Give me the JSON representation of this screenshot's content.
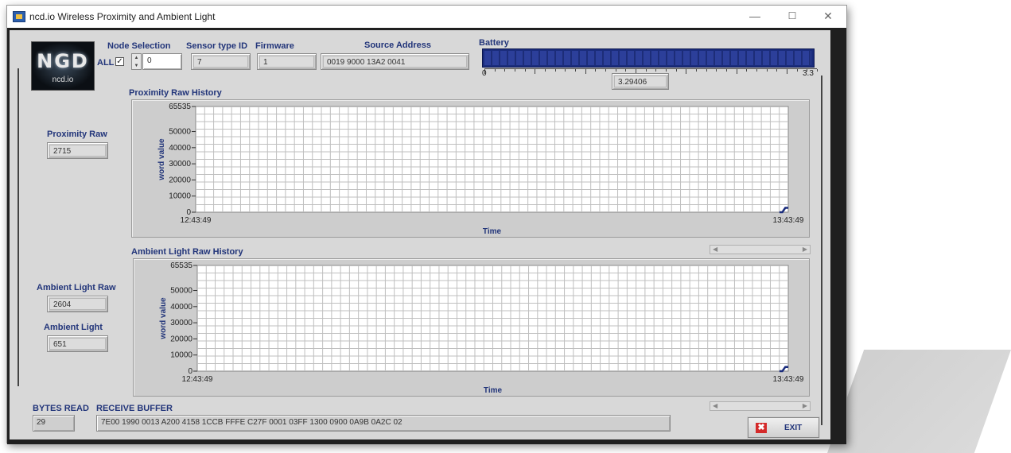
{
  "window": {
    "title": "ncd.io Wireless Proximity and Ambient Light"
  },
  "logo": {
    "brand": "NGD",
    "subtitle": "ncd.io"
  },
  "node_selection": {
    "label": "Node Selection",
    "all_label": "ALL",
    "all_checked": true,
    "value": "0"
  },
  "sensor_type": {
    "label": "Sensor type ID",
    "value": "7"
  },
  "firmware": {
    "label": "Firmware",
    "value": "1"
  },
  "source_address": {
    "label": "Source Address",
    "value": "0019 9000 13A2 0041"
  },
  "battery": {
    "label": "Battery",
    "min": "0",
    "max": "3.3",
    "value": "3.29406",
    "level_fraction": 0.998
  },
  "proximity_raw": {
    "label": "Proximity Raw",
    "value": "2715"
  },
  "ambient_light_raw": {
    "label": "Ambient Light Raw",
    "value": "2604"
  },
  "ambient_light": {
    "label": "Ambient Light",
    "value": "651"
  },
  "bytes_read": {
    "label": "BYTES READ",
    "value": "29"
  },
  "receive_buffer": {
    "label": "RECEIVE BUFFER",
    "value": "7E00 1990 0013 A200 4158 1CCB FFFE C27F 0001 03FF 1300 0900 0A9B 0A2C 02"
  },
  "exit_button": {
    "label": "EXIT"
  },
  "colors": {
    "label_blue": "#22357a",
    "battery_fill": "#1a2c7c",
    "trace": "#1a2c7c",
    "exit_icon": "#d42a2a"
  },
  "chart_data": [
    {
      "type": "line",
      "title": "Proximity Raw History",
      "xlabel": "Time",
      "ylabel": "word value",
      "x_ticks": [
        "12:43:49",
        "13:43:49"
      ],
      "y_ticks": [
        65535,
        50000,
        40000,
        30000,
        20000,
        10000,
        0
      ],
      "ylim": [
        0,
        65535
      ],
      "grid": true,
      "series": [
        {
          "x": [
            0.985,
            0.99,
            0.995,
            1.0
          ],
          "y": [
            0,
            0,
            2715,
            2715
          ]
        }
      ]
    },
    {
      "type": "line",
      "title": "Ambient Light Raw History",
      "xlabel": "Time",
      "ylabel": "word value",
      "x_ticks": [
        "12:43:49",
        "13:43:49"
      ],
      "y_ticks": [
        65535,
        50000,
        40000,
        30000,
        20000,
        10000,
        0
      ],
      "ylim": [
        0,
        65535
      ],
      "grid": true,
      "series": [
        {
          "x": [
            0.985,
            0.99,
            0.995,
            1.0
          ],
          "y": [
            0,
            0,
            2604,
            2604
          ]
        }
      ]
    }
  ]
}
